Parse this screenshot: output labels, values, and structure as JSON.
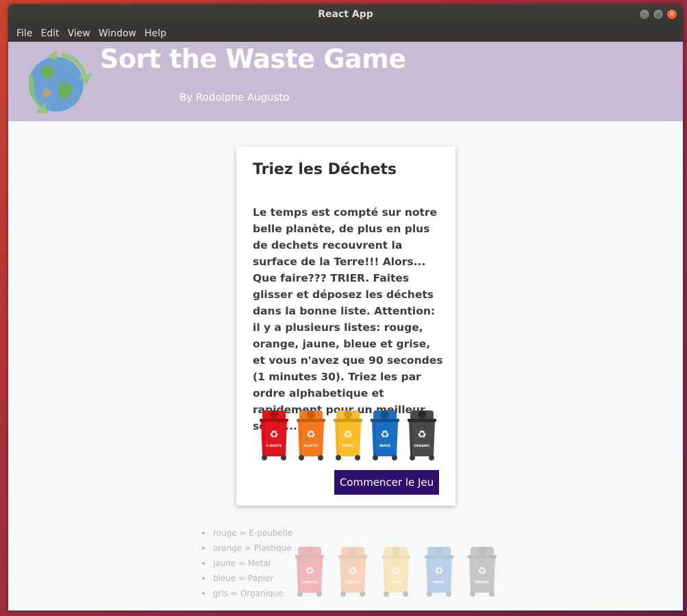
{
  "window": {
    "title": "React App",
    "controls": [
      "minimize",
      "maximize",
      "close"
    ]
  },
  "menu": [
    "File",
    "Edit",
    "View",
    "Window",
    "Help"
  ],
  "header": {
    "title": "Sort the Waste Game",
    "subtitle": "By Rodolphe Augusto",
    "logo_icon": "recycle-globe-icon"
  },
  "card": {
    "title": "Triez les Déchets",
    "description": "Le temps est compté sur notre belle planète, de plus en plus de dechets recouvrent la surface de la Terre!!! Alors... Que faire??? TRIER. Faites glisser et déposez les déchets dans la bonne liste. Attention: il y a plusieurs listes: rouge, orange, jaune, bleue et grise, et vous n'avez que 90 secondes (1 minutes 30). Triez les par ordre alphabetique et rapidement pour un meilleur score...",
    "start_button": "Commencer le Jeu",
    "bins": [
      {
        "label": "E-WASTE",
        "color": "#e0141b",
        "dark": "#a80f13"
      },
      {
        "label": "PLASTIC",
        "color": "#f47a20",
        "dark": "#c65e14"
      },
      {
        "label": "METAL",
        "color": "#f8bd2b",
        "dark": "#d39a1a"
      },
      {
        "label": "PAPER",
        "color": "#1a6fc0",
        "dark": "#12508c"
      },
      {
        "label": "ORGANIC",
        "color": "#4a4a4a",
        "dark": "#2b2b2b"
      }
    ]
  },
  "legend": [
    "rouge = E-poubelle",
    "orange = Plastique",
    "jaune = Metal",
    "bleue = Papier",
    "gris = Organique"
  ]
}
